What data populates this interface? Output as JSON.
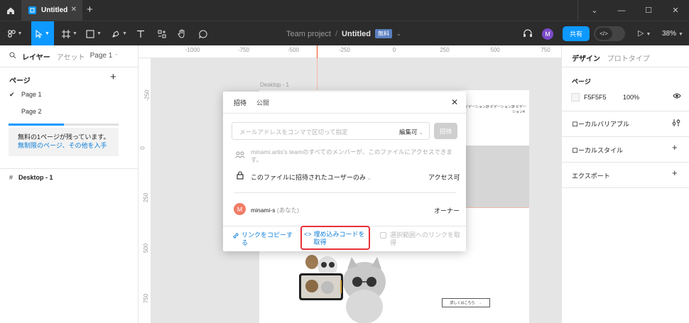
{
  "titlebar": {
    "tab_title": "Untitled",
    "tab_close": "✕",
    "new_tab": "+",
    "win_min": "—",
    "win_max": "☐",
    "win_close": "✕",
    "win_menu": "⌄"
  },
  "toolbar": {
    "project": "Team project",
    "separator": "/",
    "file_name": "Untitled",
    "plan_badge": "無料",
    "share_label": "共有",
    "avatar_letter": "M",
    "zoom": "38%",
    "code_label": "</>"
  },
  "left_panel": {
    "tab_layers": "レイヤー",
    "tab_assets": "アセット",
    "page_selector": "Page 1",
    "pages_title": "ページ",
    "add_page": "+",
    "pages": [
      {
        "name": "Page 1",
        "selected": true
      },
      {
        "name": "Page 2",
        "selected": false
      }
    ],
    "page_quota_fraction": 0.5,
    "notice_text": "無料の1ページが残っています。",
    "notice_link": "無制限のページ、その他を入手",
    "frame_name": "Desktop - 1"
  },
  "canvas": {
    "ruler_top_labels": [
      "-1000",
      "-750",
      "-500",
      "-250",
      "0",
      "250",
      "500",
      "750"
    ],
    "ruler_left_labels": [
      "-250",
      "0",
      "250",
      "500",
      "750"
    ],
    "frame_label": "Desktop - 1",
    "frame_nav": [
      "ナビゲーション2",
      "ナビゲーション3",
      "ナビゲーション4"
    ],
    "frame_cta": "詳しくはこちら　→"
  },
  "right_panel": {
    "tab_design": "デザイン",
    "tab_prototype": "プロトタイプ",
    "page_heading": "ページ",
    "page_color": "F5F5F5",
    "page_opacity": "100%",
    "local_variables": "ローカルバリアブル",
    "local_styles": "ローカルスタイル",
    "export": "エクスポート",
    "add": "+"
  },
  "modal": {
    "tab_invite": "招待",
    "tab_public": "公開",
    "close": "✕",
    "email_placeholder": "メールアドレスをコンマで区切って指定",
    "role_select": "編集可",
    "invite_button": "招待",
    "team_access_text": "minami.artis's teamのすべてのメンバーが、このファイルにアクセスできます。",
    "access_scope": "このファイルに招待されたユーザーのみ",
    "access_level": "アクセス可",
    "user_avatar": "M",
    "user_name": "minami-s",
    "user_you": "(あなた)",
    "user_role": "オーナー",
    "copy_link": "リンクをコピーする",
    "embed_code": "埋め込みコードを取得",
    "selected_link": "選択範囲へのリンクを取得"
  },
  "colors": {
    "accent": "#0d99ff",
    "chrome": "#2c2c2c",
    "highlight_border": "#e8313a"
  }
}
